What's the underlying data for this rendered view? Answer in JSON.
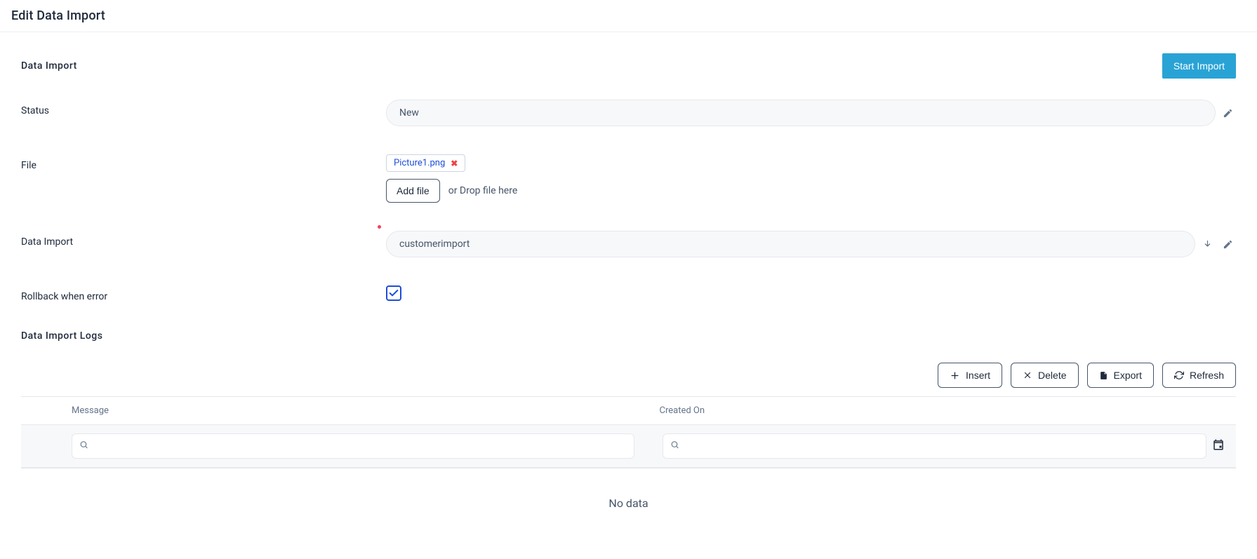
{
  "page": {
    "title": "Edit Data Import"
  },
  "header": {
    "section_label": "Data Import",
    "start_button": "Start Import"
  },
  "fields": {
    "status": {
      "label": "Status",
      "value": "New"
    },
    "file": {
      "label": "File",
      "attached_name": "Picture1.png",
      "add_button": "Add file",
      "drop_hint": "or Drop file here"
    },
    "data_import": {
      "label": "Data Import",
      "value": "customerimport",
      "required": true
    },
    "rollback": {
      "label": "Rollback when error",
      "checked": true
    }
  },
  "logs": {
    "section_label": "Data Import Logs",
    "toolbar": {
      "insert": "Insert",
      "delete": "Delete",
      "export": "Export",
      "refresh": "Refresh"
    },
    "columns": {
      "message": "Message",
      "created_on": "Created On"
    },
    "empty_text": "No data"
  }
}
